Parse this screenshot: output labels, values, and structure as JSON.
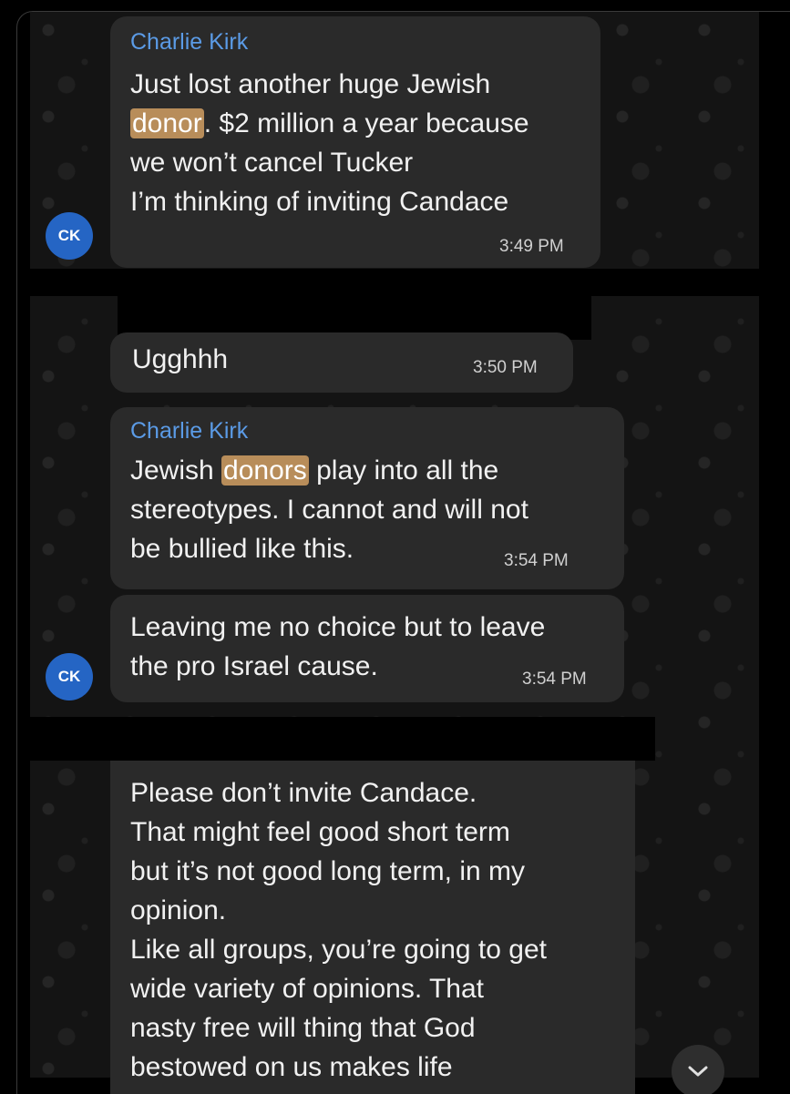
{
  "messages": [
    {
      "sender": "Charlie Kirk",
      "lines": [
        {
          "before": "Just lost another huge Jewish",
          "hl": "",
          "after": ""
        },
        {
          "before": "",
          "hl": "donor",
          "after": ". $2 million a year because"
        },
        {
          "before": "we won’t cancel Tucker",
          "hl": "",
          "after": ""
        },
        {
          "before": "I’m thinking of inviting Candace",
          "hl": "",
          "after": ""
        }
      ],
      "time": "3:49 PM",
      "avatar": "CK"
    },
    {
      "sender": "",
      "lines": [
        {
          "before": "Ugghhh",
          "hl": "",
          "after": ""
        }
      ],
      "time": "3:50 PM"
    },
    {
      "sender": "Charlie Kirk",
      "lines": [
        {
          "before": "Jewish ",
          "hl": "donors",
          "after": " play into all the"
        },
        {
          "before": "stereotypes. I cannot and will not",
          "hl": "",
          "after": ""
        },
        {
          "before": "be bullied like this.",
          "hl": "",
          "after": ""
        }
      ],
      "time": "3:54 PM"
    },
    {
      "sender": "",
      "lines": [
        {
          "before": "Leaving me no choice but to leave",
          "hl": "",
          "after": ""
        },
        {
          "before": "the pro Israel cause.",
          "hl": "",
          "after": ""
        }
      ],
      "time": "3:54 PM",
      "avatar": "CK"
    },
    {
      "sender": "",
      "lines": [
        {
          "before": "Please don’t invite Candace.",
          "hl": "",
          "after": ""
        },
        {
          "before": "That might feel good short term",
          "hl": "",
          "after": ""
        },
        {
          "before": "but it’s not good long term, in my",
          "hl": "",
          "after": ""
        },
        {
          "before": "opinion.",
          "hl": "",
          "after": ""
        },
        {
          "before": "Like all groups, you’re going to get",
          "hl": "",
          "after": ""
        },
        {
          "before": "wide variety of opinions.  That",
          "hl": "",
          "after": ""
        },
        {
          "before": "nasty free will thing that God",
          "hl": "",
          "after": ""
        },
        {
          "before": "bestowed on us makes life",
          "hl": "",
          "after": ""
        }
      ]
    }
  ],
  "icons": {
    "scroll_down": "chevron-down-icon"
  },
  "colors": {
    "sender": "#5b9be6",
    "highlight": "#b88d5a",
    "avatar": "#2565c4",
    "bubble": "#2a2a2a"
  }
}
